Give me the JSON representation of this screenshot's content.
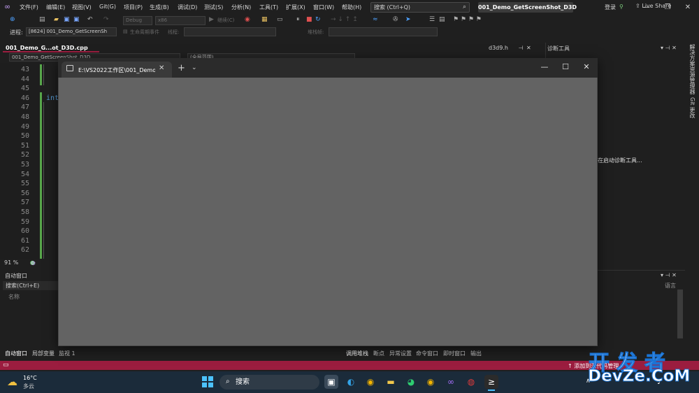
{
  "ide": {
    "menu": [
      "文件(F)",
      "编辑(E)",
      "视图(V)",
      "Git(G)",
      "项目(P)",
      "生成(B)",
      "调试(D)",
      "测试(S)",
      "分析(N)",
      "工具(T)",
      "扩展(X)",
      "窗口(W)",
      "帮助(H)"
    ],
    "search_placeholder": "搜索 (Ctrl+Q)",
    "solution_name": "001_Demo_GetScreenShot_D3D",
    "login_label": "登录",
    "live_share": "Live Share",
    "toolbar": {
      "config": "Debug",
      "platform": "x86",
      "continue_label": "继续(C)"
    },
    "procbar": {
      "process_label": "进程:",
      "process_value": "[8624] 001_Demo_GetScreenSh",
      "lifecycle_label": "生命周期事件",
      "thread_label": "线程:",
      "stack_label": "堆栈帧:"
    },
    "editor": {
      "tab_label": "001_Demo_G...ot_D3D.cpp",
      "nav_project": "001_Demo_GetScreenShot_D3D",
      "nav_scope": "(全局范围)",
      "side_file": "d3d9.h",
      "line_numbers": [
        "43",
        "44",
        "45",
        "46",
        "47",
        "48",
        "49",
        "50",
        "51",
        "52",
        "53",
        "54",
        "55",
        "56",
        "57",
        "58",
        "59",
        "60",
        "61",
        "62"
      ],
      "visible_code": "int",
      "zoom": "91 %"
    },
    "diagnostics": {
      "title": "诊断工具",
      "message": "在启动诊断工具..."
    },
    "vertical_tabs": [
      "解决方案资源管理器",
      "Git 更改"
    ],
    "auto_window": {
      "title": "自动窗口",
      "search": "搜索(Ctrl+E)",
      "column_name": "名称"
    },
    "bottom_tabs_left": [
      "自动窗口",
      "局部变量",
      "监视 1"
    ],
    "bottom_tabs_right": [
      "调用堆栈",
      "断点",
      "异常设置",
      "命令窗口",
      "即时窗口",
      "输出"
    ],
    "right_pane_column": "语言",
    "status_message": "添加到源代码管理"
  },
  "terminal": {
    "tab_title": "E:\\VS2022工作区\\001_Demo_G"
  },
  "watermark": {
    "line1": "开发者",
    "line2": "DevZe.CoM"
  },
  "taskbar": {
    "temperature": "16°C",
    "weather": "多云",
    "search_label": "搜索"
  },
  "colors": {
    "accent": "#9b1d3f",
    "terminal_body": "#636363"
  }
}
